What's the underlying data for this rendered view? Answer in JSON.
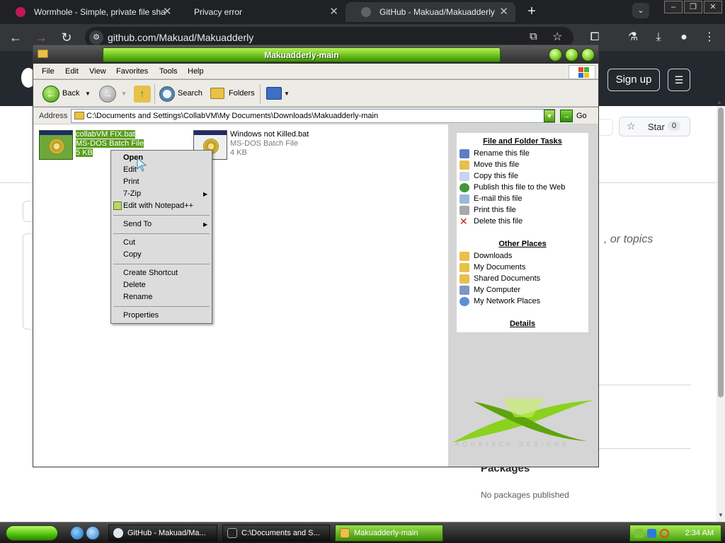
{
  "browser": {
    "tabs": [
      {
        "title": "Wormhole - Simple, private file sha",
        "favicon": "wormhole-icon",
        "active": false
      },
      {
        "title": "Privacy error",
        "favicon": "warning-icon",
        "active": false
      },
      {
        "title": "GitHub - Makuad/Makuadderly",
        "favicon": "github-icon",
        "active": true
      }
    ],
    "url": "github.com/Makuad/Makuadderly"
  },
  "github": {
    "signup_label": "Sign up",
    "star_label": "Star",
    "star_count": "0",
    "topics_fragment": ", or topics",
    "packages_title": "Packages",
    "packages_text": "No packages published"
  },
  "explorer": {
    "title": "Makuadderly-main",
    "menu": [
      "File",
      "Edit",
      "View",
      "Favorites",
      "Tools",
      "Help"
    ],
    "toolbar": {
      "back": "Back",
      "search": "Search",
      "folders": "Folders"
    },
    "address_label": "Address",
    "address_path": "C:\\Documents and Settings\\CollabVM\\My Documents\\Downloads\\Makuadderly-main",
    "go_label": "Go",
    "files": [
      {
        "name": "collabVM FIX.bat",
        "type": "MS-DOS Batch File",
        "size": "5 KB",
        "selected": true
      },
      {
        "name": "Windows not Killed.bat",
        "type": "MS-DOS Batch File",
        "size": "4 KB",
        "selected": false
      }
    ],
    "file_tasks_title": "File and Folder Tasks",
    "file_tasks": [
      "Rename this file",
      "Move this file",
      "Copy this file",
      "Publish this file to the Web",
      "E-mail this file",
      "Print this file",
      "Delete this file"
    ],
    "other_places_title": "Other Places",
    "other_places": [
      "Downloads",
      "My Documents",
      "Shared Documents",
      "My Computer",
      "My Network Places"
    ],
    "details_title": "Details",
    "logo_caption": "AQUAJACK DESIGNS"
  },
  "context_menu": {
    "items": [
      "Open",
      "Edit",
      "Print",
      "7-Zip",
      "Edit with Notepad++",
      "Send To",
      "Cut",
      "Copy",
      "Create Shortcut",
      "Delete",
      "Rename",
      "Properties"
    ]
  },
  "taskbar": {
    "tasks": [
      "GitHub - Makuad/Ma...",
      "C:\\Documents and S...",
      "Makuadderly-main"
    ],
    "clock": "2:34 AM"
  }
}
